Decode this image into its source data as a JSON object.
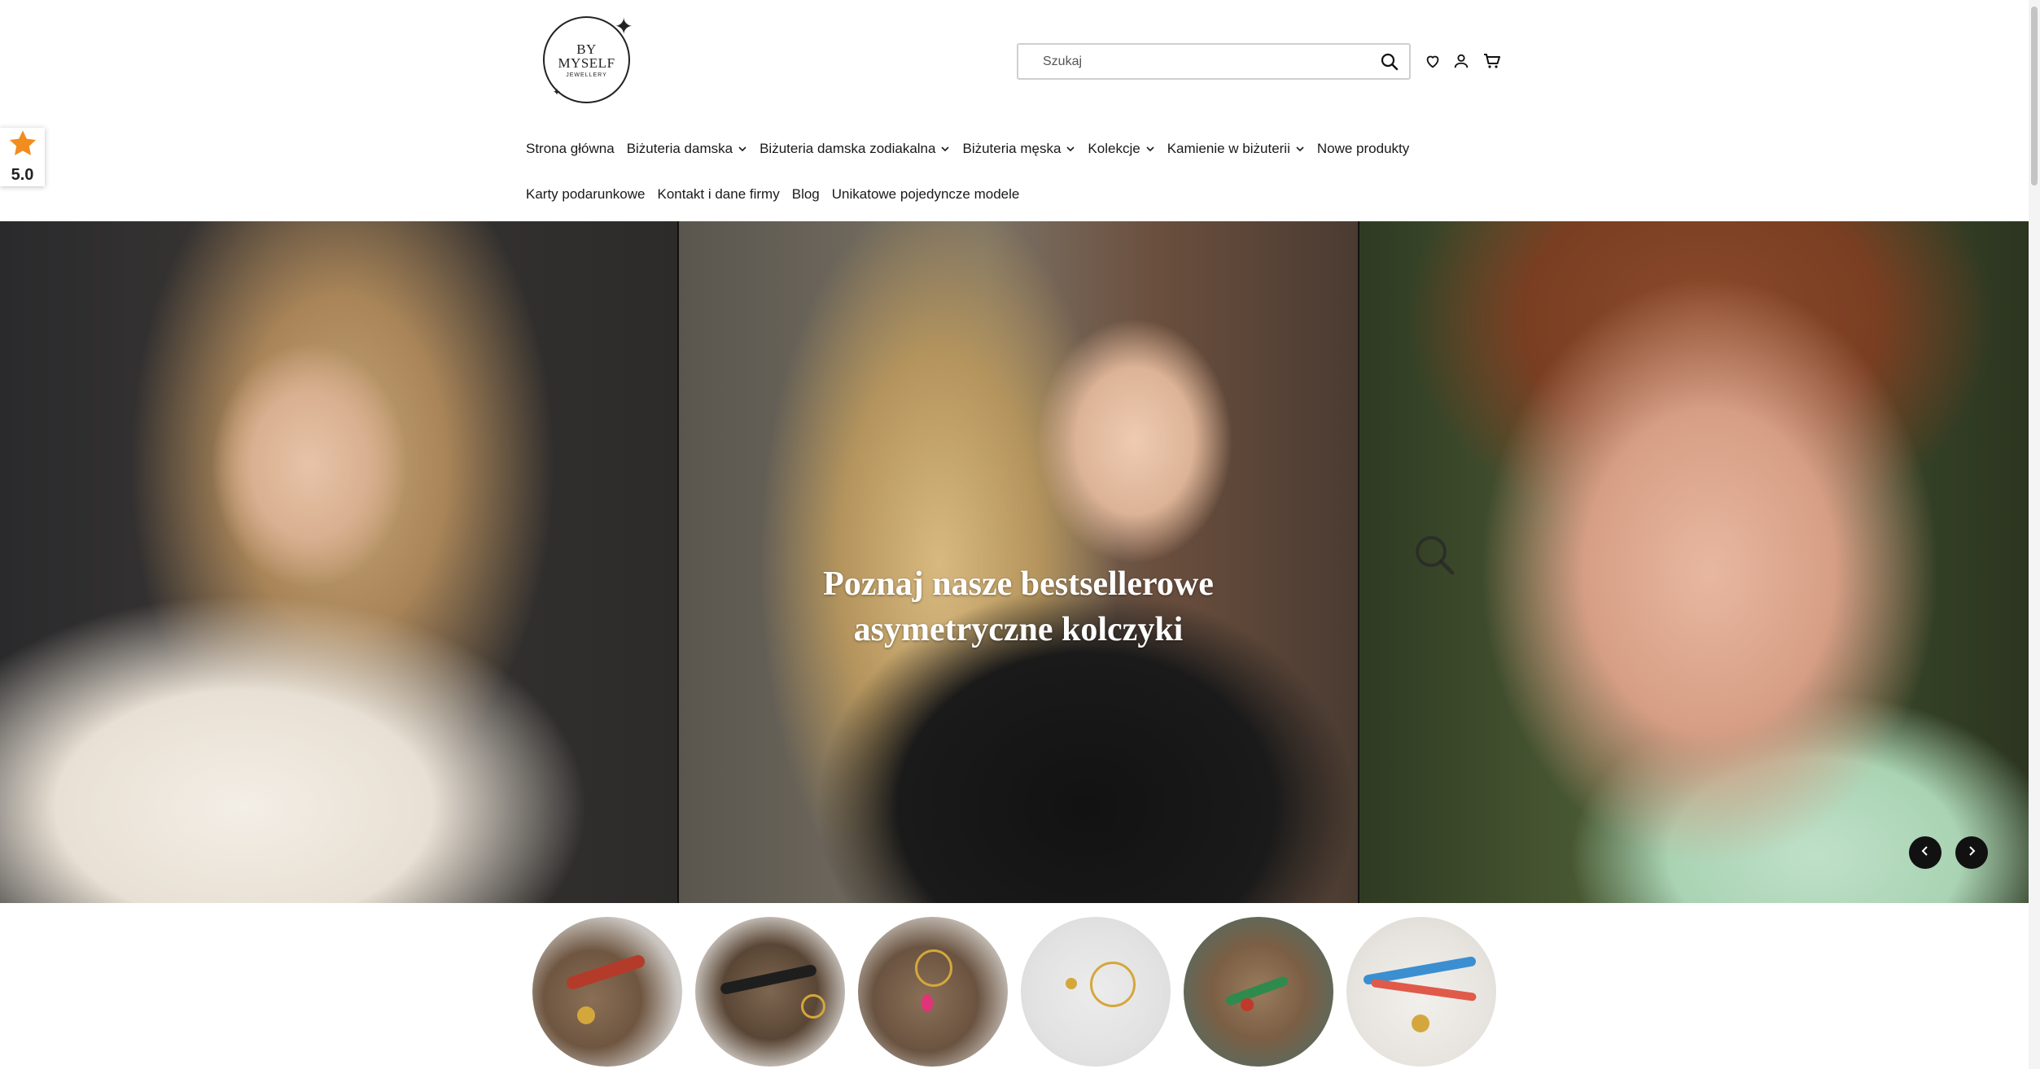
{
  "logo": {
    "line1": "BY",
    "line2": "MYSELF",
    "line3": "JEWELLERY"
  },
  "search": {
    "placeholder": "Szukaj"
  },
  "header_icons": [
    "search-icon",
    "heart-icon",
    "user-icon",
    "cart-icon"
  ],
  "rating": {
    "value": "5.0",
    "icon": "star-icon",
    "color": "#f28c1e"
  },
  "nav": {
    "row1": [
      {
        "label": "Strona główna",
        "dropdown": false
      },
      {
        "label": "Biżuteria damska",
        "dropdown": true
      },
      {
        "label": "Biżuteria damska zodiakalna",
        "dropdown": true
      },
      {
        "label": "Biżuteria męska",
        "dropdown": true
      },
      {
        "label": "Kolekcje",
        "dropdown": true
      },
      {
        "label": "Kamienie w biżuterii",
        "dropdown": true
      },
      {
        "label": "Nowe produkty",
        "dropdown": false
      }
    ],
    "row2": [
      {
        "label": "Karty podarunkowe",
        "dropdown": false
      },
      {
        "label": "Kontakt i dane firmy",
        "dropdown": false
      },
      {
        "label": "Blog",
        "dropdown": false
      },
      {
        "label": "Unikatowe pojedyncze modele",
        "dropdown": false
      }
    ]
  },
  "hero": {
    "caption_line1": "Poznaj nasze bestsellerowe",
    "caption_line2": "asymetryczne kolczyki"
  },
  "colors": {
    "text": "#1a1a1a",
    "arrow_bg": "#111111"
  }
}
